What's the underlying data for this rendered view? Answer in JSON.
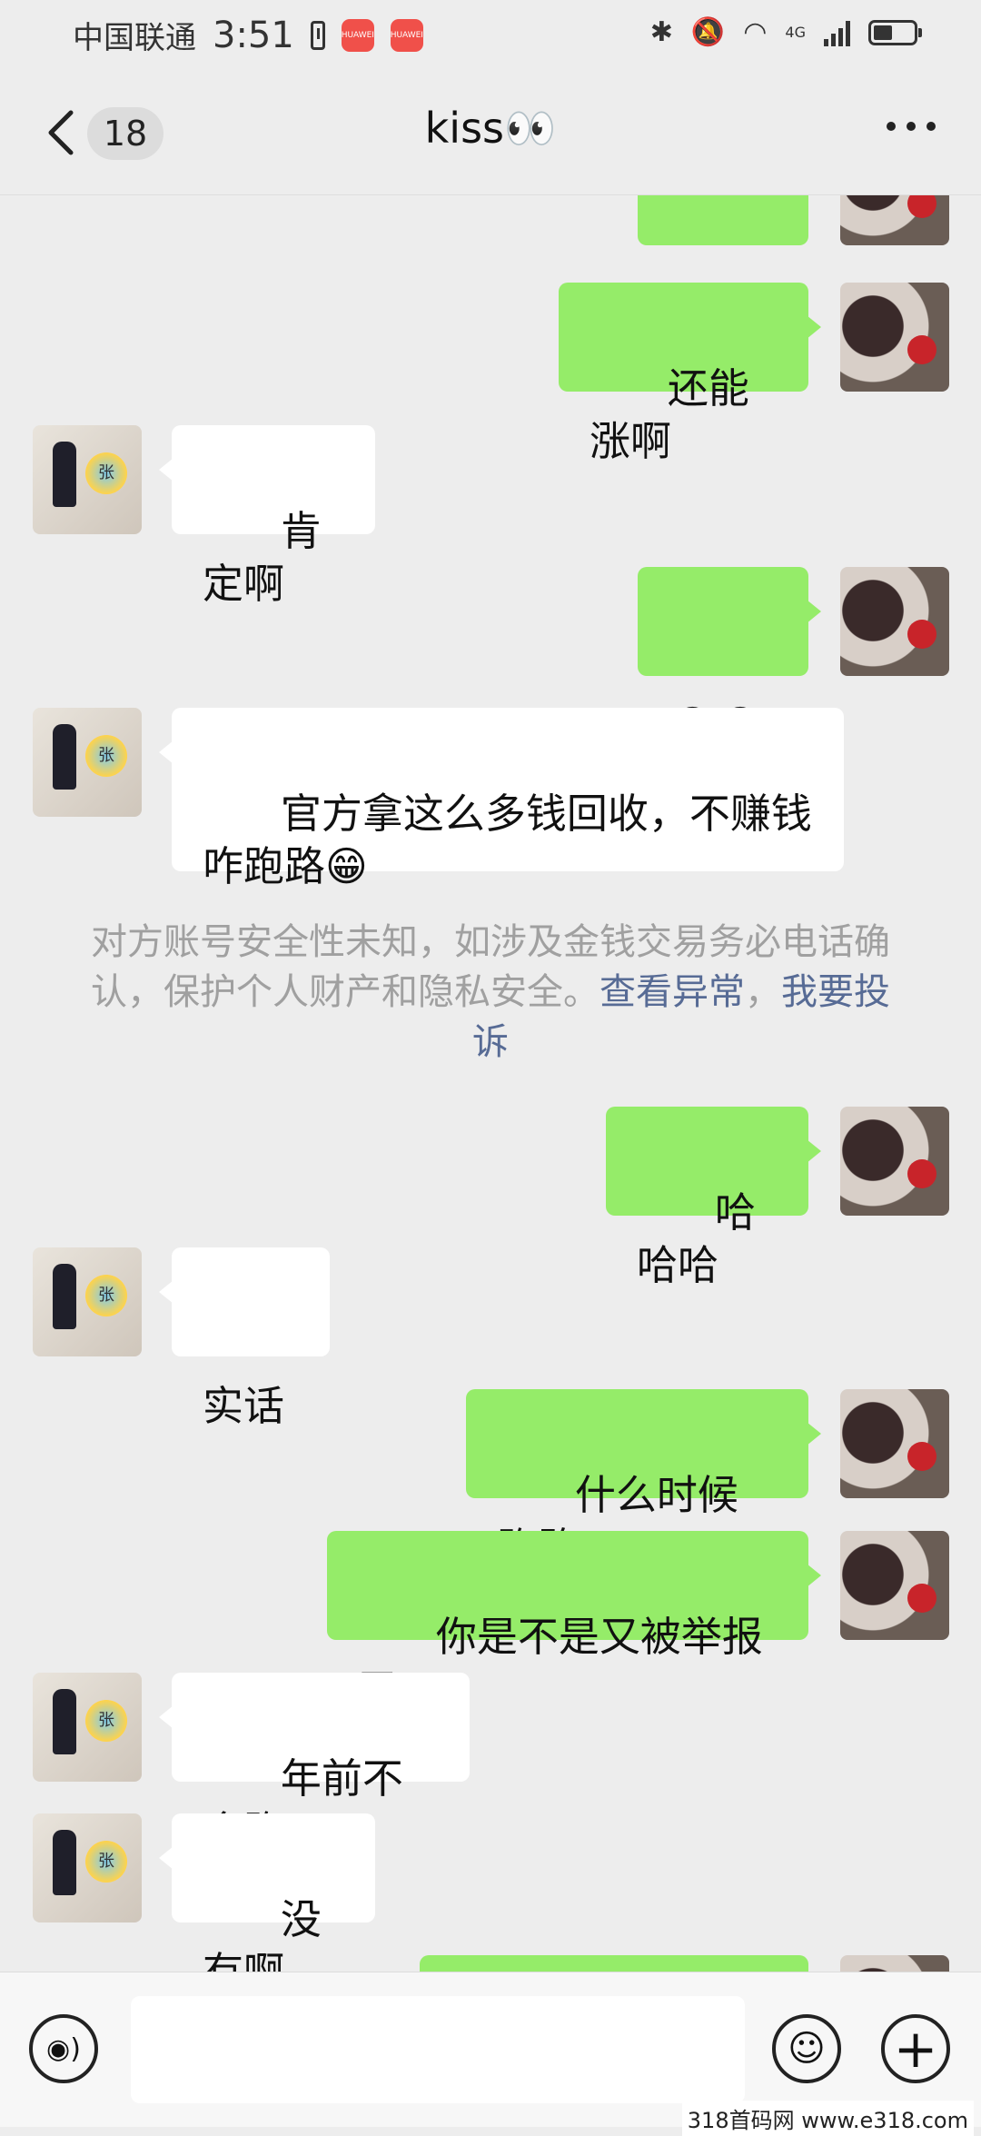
{
  "status_bar": {
    "carrier": "中国联通",
    "time": "3:51",
    "app_badge_1": "HUAWEI",
    "app_badge_2": "HUAWEI",
    "network": "4G"
  },
  "header": {
    "unread_count": "18",
    "title": "kiss👀"
  },
  "messages": [
    {
      "from": "me",
      "text": "😂😂"
    },
    {
      "from": "me",
      "text": "还能涨啊"
    },
    {
      "from": "other",
      "text": "肯定啊"
    },
    {
      "from": "me",
      "text": "😂😂"
    },
    {
      "from": "other",
      "text": "官方拿这么多钱回收，不赚钱\n咋跑路😁"
    },
    {
      "from": "me",
      "text": "哈哈哈"
    },
    {
      "from": "other",
      "text": "实话"
    },
    {
      "from": "me",
      "text": "什么时候跑路"
    },
    {
      "from": "me",
      "text": "你是不是又被举报了"
    },
    {
      "from": "other",
      "text": "年前不会跑"
    },
    {
      "from": "other",
      "text": "没有啊"
    },
    {
      "from": "me",
      "text": ""
    }
  ],
  "system_notice": {
    "text": "对方账号安全性未知，如涉及金钱交易务必电话确认，保护个人财产和隐私安全。",
    "link_view": "查看异常",
    "separator": "，",
    "link_report": "我要投诉"
  },
  "avatars": {
    "other_badge_text": "张"
  },
  "input_bar": {
    "placeholder": ""
  },
  "watermark": "318首码网 www.e318.com",
  "colors": {
    "my_bubble": "#95ec69",
    "other_bubble": "#ffffff",
    "background": "#ededed",
    "link": "#576b95"
  }
}
